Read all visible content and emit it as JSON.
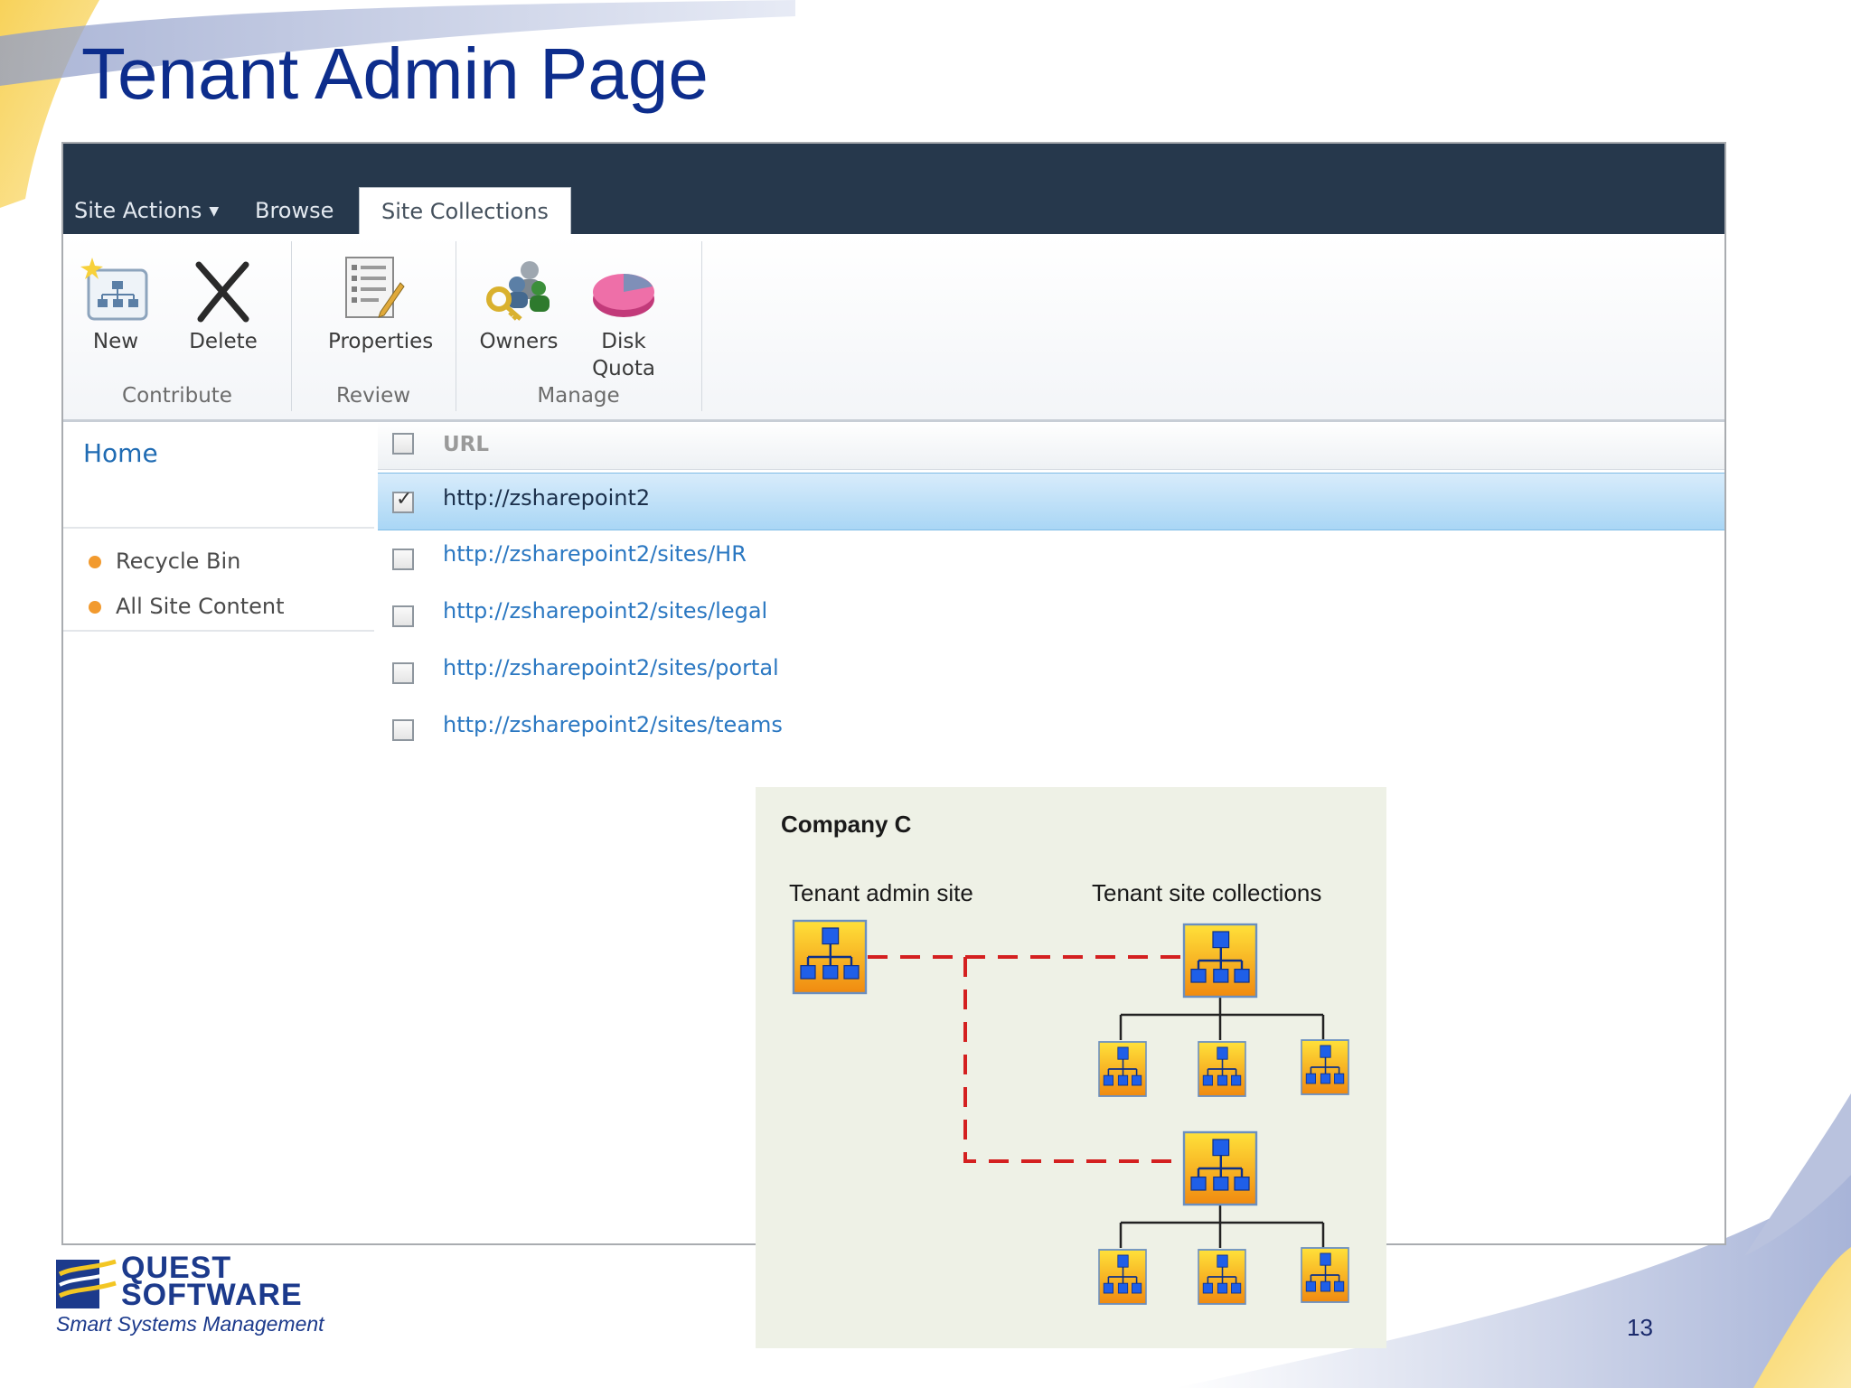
{
  "slide": {
    "title": "Tenant Admin Page",
    "page_number": "13"
  },
  "tabs": [
    {
      "label": "Site Actions",
      "has_dropdown": true
    },
    {
      "label": "Browse"
    },
    {
      "label": "Site Collections",
      "active": true
    }
  ],
  "ribbon": {
    "groups": [
      {
        "label": "Contribute",
        "buttons": [
          {
            "label": "New",
            "icon": "new-site-icon"
          },
          {
            "label": "Delete",
            "icon": "delete-icon"
          }
        ]
      },
      {
        "label": "Review",
        "buttons": [
          {
            "label": "Properties",
            "icon": "properties-icon"
          }
        ]
      },
      {
        "label": "Manage",
        "buttons": [
          {
            "label": "Owners",
            "icon": "owners-icon"
          },
          {
            "label": "Disk Quota",
            "line1": "Disk",
            "line2": "Quota",
            "icon": "disk-quota-icon"
          }
        ]
      }
    ]
  },
  "leftnav": {
    "home": "Home",
    "items": [
      {
        "label": "Recycle Bin"
      },
      {
        "label": "All Site Content"
      }
    ]
  },
  "list": {
    "header": "URL",
    "rows": [
      {
        "url": "http://zsharepoint2",
        "selected": true
      },
      {
        "url": "http://zsharepoint2/sites/HR",
        "selected": false
      },
      {
        "url": "http://zsharepoint2/sites/legal",
        "selected": false
      },
      {
        "url": "http://zsharepoint2/sites/portal",
        "selected": false
      },
      {
        "url": "http://zsharepoint2/sites/teams",
        "selected": false
      }
    ]
  },
  "diagram": {
    "title": "Company C",
    "left_label": "Tenant admin site",
    "right_label": "Tenant site collections"
  },
  "logo": {
    "line1": "QUEST",
    "line2": "SOFTWARE",
    "tagline": "Smart Systems Management"
  },
  "colors": {
    "title": "#0d2d8c",
    "topbar": "#26384c",
    "link": "#2b78c2",
    "selected_row": "#a9d6f5",
    "dashed_line": "#d42020",
    "diagram_bg": "#eef1e6"
  }
}
